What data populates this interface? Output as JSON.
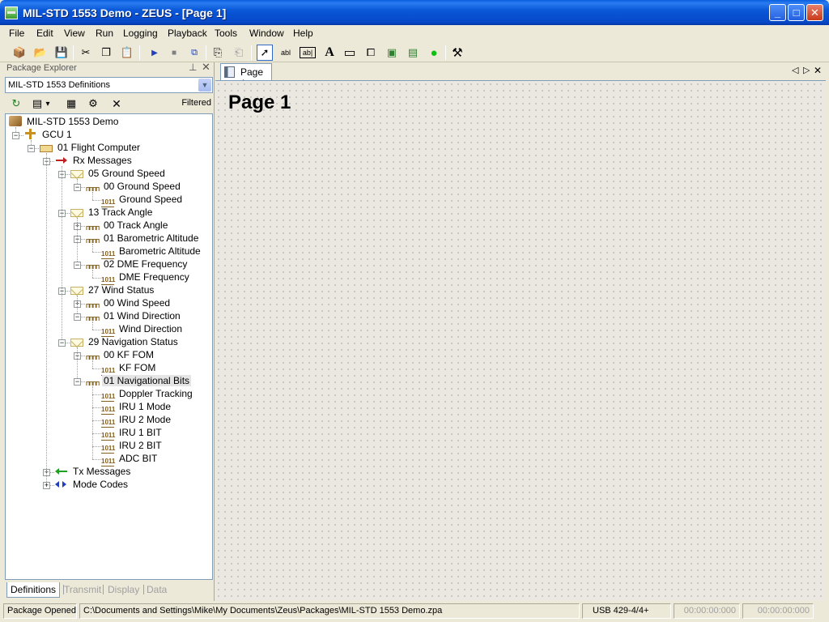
{
  "window": {
    "title": "MIL-STD 1553 Demo - ZEUS - [Page 1]",
    "controls": {
      "minimize": "_",
      "maximize": "□",
      "close": "✕"
    }
  },
  "menu": [
    "File",
    "Edit",
    "View",
    "Run",
    "Logging",
    "Playback",
    "Tools",
    "Window",
    "Help"
  ],
  "toolbar": {
    "buttons": [
      {
        "name": "new-package-icon",
        "glyph": "📦"
      },
      {
        "name": "open-folder-icon",
        "glyph": "📂"
      },
      {
        "name": "save-icon",
        "glyph": "💾"
      },
      {
        "name": "cut-icon",
        "glyph": "✂"
      },
      {
        "name": "copy-icon",
        "glyph": "❐"
      },
      {
        "name": "paste-icon",
        "glyph": "📋"
      },
      {
        "name": "run-icon",
        "glyph": "▶"
      },
      {
        "name": "stop-icon",
        "glyph": "■"
      },
      {
        "name": "step-icon",
        "glyph": "⧉"
      },
      {
        "name": "copy-page-icon",
        "glyph": "⎘"
      },
      {
        "name": "paste-page-icon",
        "glyph": "⎗"
      },
      {
        "name": "select-pointer-icon",
        "glyph": "➚"
      },
      {
        "name": "text-box-icon",
        "glyph": "abl"
      },
      {
        "name": "text-field-icon",
        "glyph": "ab|"
      },
      {
        "name": "label-icon",
        "glyph": "A"
      },
      {
        "name": "rectangle-icon",
        "glyph": "▭"
      },
      {
        "name": "group-icon",
        "glyph": "⧠"
      },
      {
        "name": "image-icon",
        "glyph": "▣"
      },
      {
        "name": "gauge-icon",
        "glyph": "▤"
      },
      {
        "name": "led-icon",
        "glyph": "●"
      },
      {
        "name": "tools-icon",
        "glyph": "⚒"
      }
    ]
  },
  "package_explorer": {
    "title": "Package Explorer",
    "pin": "⊥",
    "close": "✕",
    "combo_value": "MIL-STD 1553 Definitions",
    "tools": [
      {
        "name": "refresh-icon",
        "glyph": "↻"
      },
      {
        "name": "view-options-icon",
        "glyph": "▤"
      },
      {
        "name": "dropdown-arrow-icon",
        "glyph": "▾"
      },
      {
        "name": "properties-icon",
        "glyph": "▦"
      },
      {
        "name": "settings-icon",
        "glyph": "⚙"
      },
      {
        "name": "delete-icon",
        "glyph": "✕"
      }
    ],
    "filtered_label": "Filtered",
    "tree": [
      {
        "label": "MIL-STD 1553 Demo",
        "level": 0,
        "icon": "pkg"
      },
      {
        "label": "GCU 1",
        "level": 1,
        "icon": "gcu",
        "expander": "-"
      },
      {
        "label": "01 Flight Computer",
        "level": 2,
        "icon": "fc",
        "expander": "-"
      },
      {
        "label": "Rx Messages",
        "level": 3,
        "icon": "rx",
        "expander": "-"
      },
      {
        "label": "05 Ground Speed",
        "level": 4,
        "icon": "env",
        "expander": "-"
      },
      {
        "label": "00 Ground Speed",
        "level": 5,
        "icon": "word",
        "expander": "-"
      },
      {
        "label": "Ground Speed",
        "level": 6,
        "icon": "bits"
      },
      {
        "label": "13 Track Angle",
        "level": 4,
        "icon": "env",
        "expander": "-"
      },
      {
        "label": "00 Track Angle",
        "level": 5,
        "icon": "word",
        "expander": "+"
      },
      {
        "label": "01 Barometric Altitude",
        "level": 5,
        "icon": "word",
        "expander": "-"
      },
      {
        "label": "Barometric Altitude",
        "level": 6,
        "icon": "bits"
      },
      {
        "label": "02 DME Frequency",
        "level": 5,
        "icon": "word",
        "expander": "-"
      },
      {
        "label": "DME Frequency",
        "level": 6,
        "icon": "bits"
      },
      {
        "label": "27 Wind Status",
        "level": 4,
        "icon": "env",
        "expander": "-"
      },
      {
        "label": "00 Wind Speed",
        "level": 5,
        "icon": "word",
        "expander": "+"
      },
      {
        "label": "01 Wind Direction",
        "level": 5,
        "icon": "word",
        "expander": "-"
      },
      {
        "label": "Wind Direction",
        "level": 6,
        "icon": "bits"
      },
      {
        "label": "29 Navigation Status",
        "level": 4,
        "icon": "env",
        "expander": "-"
      },
      {
        "label": "00 KF FOM",
        "level": 5,
        "icon": "word",
        "expander": "-"
      },
      {
        "label": "KF FOM",
        "level": 6,
        "icon": "bits"
      },
      {
        "label": "01 Navigational Bits",
        "level": 5,
        "icon": "word",
        "expander": "-",
        "selected": true
      },
      {
        "label": "Doppler Tracking",
        "level": 6,
        "icon": "bits"
      },
      {
        "label": "IRU 1 Mode",
        "level": 6,
        "icon": "bits"
      },
      {
        "label": "IRU 2 Mode",
        "level": 6,
        "icon": "bits"
      },
      {
        "label": "IRU 1 BIT",
        "level": 6,
        "icon": "bits"
      },
      {
        "label": "IRU 2 BIT",
        "level": 6,
        "icon": "bits"
      },
      {
        "label": "ADC BIT",
        "level": 6,
        "icon": "bits"
      },
      {
        "label": "Tx Messages",
        "level": 3,
        "icon": "tx",
        "expander": "+"
      },
      {
        "label": "Mode Codes",
        "level": 3,
        "icon": "mc",
        "expander": "+"
      }
    ],
    "bottom_tabs": [
      "Definitions",
      "Transmit",
      "Display",
      "Data"
    ]
  },
  "document": {
    "tab_label": "Page 1",
    "nav": {
      "left": "◁",
      "right": "▷",
      "close": "✕"
    },
    "page_title": "Page 1"
  },
  "status": {
    "message": "Package Opened",
    "path": "C:\\Documents and Settings\\Mike\\My Documents\\Zeus\\Packages\\MIL-STD 1553 Demo.zpa",
    "device": "USB 429-4/4+",
    "time1": "00:00:00:000",
    "time2": "00:00:00:000"
  }
}
